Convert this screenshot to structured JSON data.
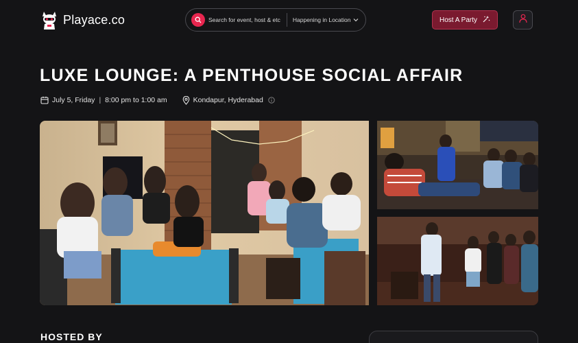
{
  "header": {
    "brand": "Playace.co",
    "search_placeholder": "Search for event, host & etc",
    "location_label": "Happening in Location",
    "host_button": "Host A Party",
    "icons": {
      "search": "search-icon",
      "chevron": "chevron-down-icon",
      "sparkle": "sparkle-icon",
      "profile": "user-icon"
    }
  },
  "event": {
    "title": "LUXE LOUNGE: A PENTHOUSE SOCIAL AFFAIR",
    "date": "July 5, Friday",
    "time": "8:00 pm to 1:00 am",
    "location": "Kondapur, Hyderabad"
  },
  "section": {
    "hosted_by": "HOSTED BY"
  },
  "colors": {
    "accent": "#e8264f",
    "host_button_bg": "#7a1a2f",
    "background": "#141416"
  }
}
